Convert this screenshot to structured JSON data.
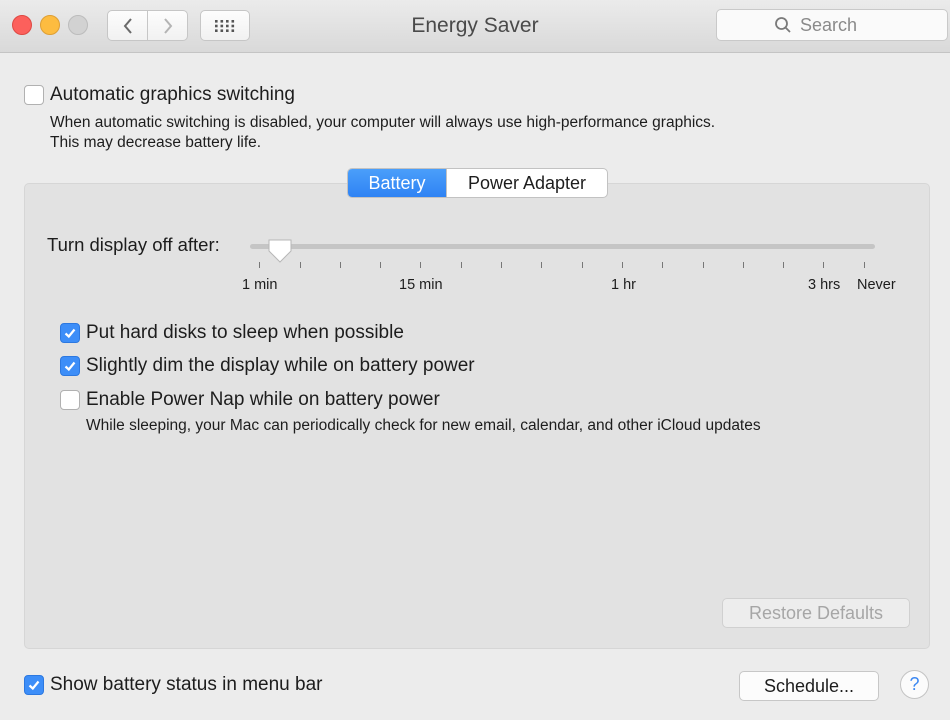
{
  "window": {
    "title": "Energy Saver",
    "search_placeholder": "Search"
  },
  "graphics": {
    "label": "Automatic graphics switching",
    "checked": false,
    "desc_line1": "When automatic switching is disabled, your computer will always use high-performance graphics.",
    "desc_line2": "This may decrease battery life."
  },
  "tabs": [
    {
      "label": "Battery",
      "active": true
    },
    {
      "label": "Power Adapter",
      "active": false
    }
  ],
  "display_off": {
    "label": "Turn display off after:",
    "tick_labels": [
      "1 min",
      "15 min",
      "1 hr",
      "3 hrs",
      "Never"
    ],
    "selected_value": "2 min"
  },
  "options": [
    {
      "label": "Put hard disks to sleep when possible",
      "checked": true
    },
    {
      "label": "Slightly dim the display while on battery power",
      "checked": true
    },
    {
      "label": "Enable Power Nap while on battery power",
      "checked": false,
      "desc": "While sleeping, your Mac can periodically check for new email, calendar, and other iCloud updates"
    }
  ],
  "restore_defaults": "Restore Defaults",
  "battery_status": {
    "label": "Show battery status in menu bar",
    "checked": true
  },
  "schedule_button": "Schedule...",
  "help_button": "?",
  "colors": {
    "accent": "#3d8ef8",
    "close": "#fc605c",
    "minimize": "#fdbc40"
  }
}
